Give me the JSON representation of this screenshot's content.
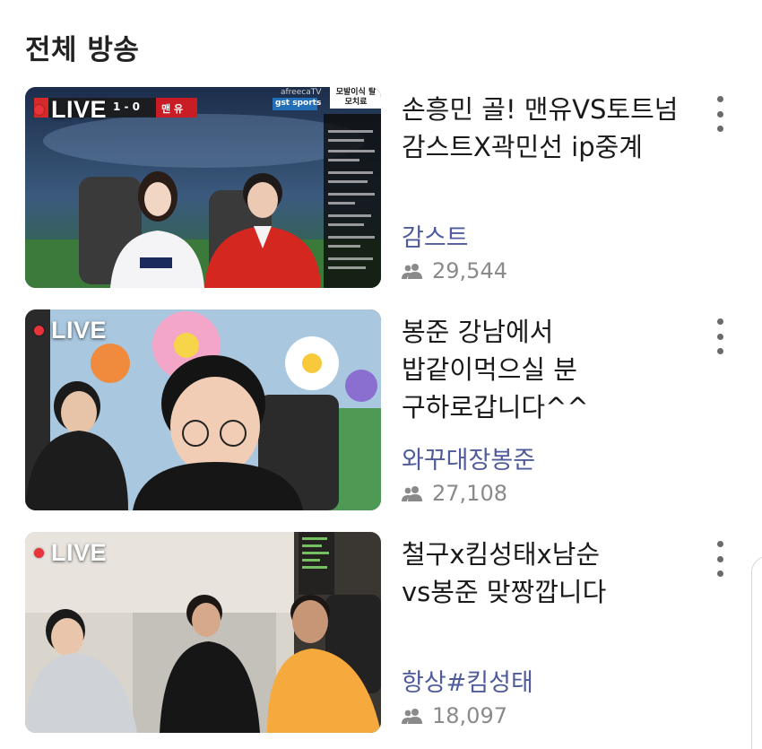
{
  "header": {
    "title": "전체 방송"
  },
  "live_label": "LIVE",
  "broadcasts": [
    {
      "title": "손흥민 골! 맨유VS토트넘 감스트X곽민선 ip중계",
      "channel": "감스트",
      "viewers": "29,544",
      "thumb": {
        "score": "1 - 0",
        "team": "맨 유",
        "brand": "afreecaTV",
        "sponsor": "gst sports",
        "banner": "모발이식 탈모치료"
      }
    },
    {
      "title": "봉준 강남에서 밥같이먹으실 분 구하로갑니다^^",
      "channel": "와꾸대장봉준",
      "viewers": "27,108"
    },
    {
      "title": "철구x킴성태x남순 vs봉준 맞짱깝니다",
      "channel": "항상#킴성태",
      "viewers": "18,097"
    }
  ],
  "colors": {
    "channel": "#4f5b9a",
    "live_dot": "#e8333a",
    "viewer_text": "#8a8a8a"
  },
  "icons": {
    "viewers": "people-icon",
    "menu": "more-vertical-icon"
  }
}
